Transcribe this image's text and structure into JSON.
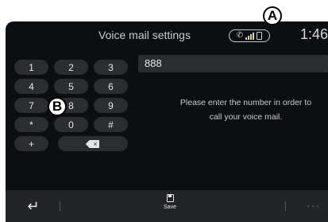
{
  "status_bar": {
    "title": "Voice mail settings",
    "time": "1:46",
    "phone_status_icons": [
      "phone-icon",
      "signal-bars-icon",
      "battery-icon"
    ]
  },
  "keypad": {
    "keys": [
      "1",
      "2",
      "3",
      "4",
      "5",
      "6",
      "7",
      "8",
      "9",
      "*",
      "0",
      "#",
      "+"
    ],
    "backspace_icon": "backspace-icon"
  },
  "number_field": {
    "value": "888"
  },
  "hint": {
    "line1": "Please enter the number in order to",
    "line2": "call your voice mail."
  },
  "bottom_bar": {
    "back_icon": "back-arrow-icon",
    "save_label": "Save",
    "more_label": "···"
  },
  "callouts": {
    "a": "A",
    "b": "B"
  },
  "colors": {
    "background": "#0d0e11",
    "key": "#2b2d31",
    "bottom_bar": "#232428",
    "text": "#e6e7ea"
  }
}
